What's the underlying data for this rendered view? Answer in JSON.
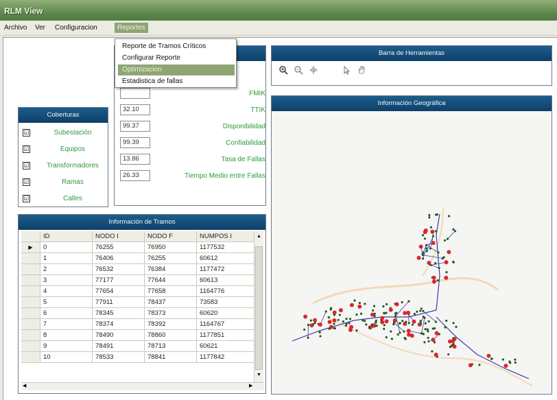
{
  "window": {
    "title": "RLM View"
  },
  "menu": {
    "items": [
      "Archivo",
      "Ver",
      "Configuracion",
      "Reportes"
    ],
    "dropdown": [
      "Reporte de Tramos Críticos",
      "Configurar Reporte",
      "Optimizacion",
      "Estadistica de fallas"
    ]
  },
  "indicadores": {
    "rows": [
      {
        "value": "",
        "label": "FMIK"
      },
      {
        "value": "32.10",
        "label": "TTIK"
      },
      {
        "value": "99.37",
        "label": "Disponibilidad"
      },
      {
        "value": "99.39",
        "label": "Confiabilidad"
      },
      {
        "value": "13.86",
        "label": "Tasa de Fallas"
      },
      {
        "value": "26.33",
        "label": "Tiempo Medio entre Fallas"
      }
    ]
  },
  "coberturas": {
    "title": "Coberturas",
    "items": [
      "Subestación",
      "Equipos",
      "Transformadores",
      "Ramas",
      "Calles"
    ],
    "check_glyph": "☑"
  },
  "toolbar": {
    "title": "Barra de Herramientas",
    "icons": [
      "zoom-in-icon",
      "zoom-out-icon",
      "pan-icon",
      "pointer-icon",
      "hand-icon"
    ]
  },
  "geo": {
    "title": "Información Geográfica"
  },
  "tramos": {
    "title": "Información de Tramos",
    "columns": [
      "ID",
      "NODO I",
      "NODO F",
      "NUMPOS I"
    ],
    "rows": [
      [
        "0",
        "76255",
        "76950",
        "1177532"
      ],
      [
        "1",
        "76406",
        "76255",
        "60612"
      ],
      [
        "2",
        "76532",
        "76384",
        "1177472"
      ],
      [
        "3",
        "77177",
        "77644",
        "60613"
      ],
      [
        "4",
        "77654",
        "77658",
        "1164776"
      ],
      [
        "5",
        "77911",
        "78437",
        "73583"
      ],
      [
        "6",
        "78345",
        "78373",
        "60620"
      ],
      [
        "7",
        "78374",
        "78392",
        "1164767"
      ],
      [
        "8",
        "78490",
        "78860",
        "1177851"
      ],
      [
        "9",
        "78491",
        "78713",
        "60621"
      ],
      [
        "10",
        "78533",
        "78841",
        "1177842"
      ]
    ]
  },
  "colors": {
    "panel_header": "#1a5584",
    "menu_highlight": "#8fa574",
    "label_green": "#2c9a3a",
    "map_line": "#3a3aa8",
    "map_node": "#d8282e",
    "map_small_node": "#1f5a24"
  }
}
